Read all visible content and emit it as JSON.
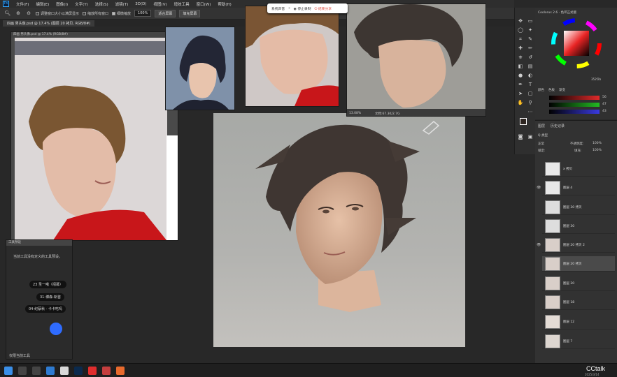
{
  "menubar": {
    "logo": "Ps",
    "items": [
      "文件(F)",
      "编辑(E)",
      "图像(I)",
      "文字(Y)",
      "选择(S)",
      "滤镜(T)",
      "3D(D)",
      "视图(V)",
      "增效工具",
      "窗口(W)",
      "帮助(H)"
    ]
  },
  "options": {
    "check_resize": "调整窗口大小以满屏显示",
    "check_all_windows": "缩放所有窗口",
    "check_scrubby": "细微缩放",
    "zoom_value": "100%",
    "fit_screen": "适合屏幕",
    "fill_screen": "填充屏幕"
  },
  "tabs": [
    {
      "label": "四画  男头像.psd @ 17.4% (图层 20 拷贝, RGB/8#)"
    }
  ],
  "windows": {
    "small_title": "四画  男头像.psd @ 17.4% (RGB/8#)",
    "ref2_status": "13.08%",
    "ref2_status2": "文档:67.3K/2.7G"
  },
  "recorder": {
    "mic": "系统声音",
    "stop": "停止录制",
    "end": "结束分享"
  },
  "color_panel": {
    "title": "Coolorus 2.6 · 色环正式版",
    "tabs": [
      "颜色",
      "色板",
      "渐变"
    ],
    "slider_values": [
      "56",
      "47",
      "43"
    ],
    "hex_readout": "352f2b"
  },
  "layers_panel": {
    "tabs": [
      "图层",
      "历史记录"
    ],
    "kind_label": "Q 类型",
    "blend": "正常",
    "opacity_label": "不透明度:",
    "opacity": "100%",
    "fill_label": "填充:",
    "fill": "100%",
    "lock_label": "锁定:",
    "layers": [
      {
        "name": "x 拷贝",
        "visible": false,
        "selected": false
      },
      {
        "name": "图层 4",
        "visible": true,
        "selected": false
      },
      {
        "name": "图层 30 拷贝",
        "visible": false,
        "selected": false
      },
      {
        "name": "图层 30",
        "visible": false,
        "selected": false
      },
      {
        "name": "图层 20 拷贝 2",
        "visible": true,
        "selected": false
      },
      {
        "name": "图层 20 拷贝",
        "visible": false,
        "selected": true
      },
      {
        "name": "图层 20",
        "visible": false,
        "selected": false
      },
      {
        "name": "图层 18",
        "visible": false,
        "selected": false
      },
      {
        "name": "图层 12",
        "visible": false,
        "selected": false
      },
      {
        "name": "图层 7",
        "visible": false,
        "selected": false
      }
    ]
  },
  "presets_panel": {
    "title": "工具预设",
    "empty_text": "当前工具没有定义的工具预设。",
    "presets": [
      "23 圣一哦（招募）",
      "31-博森-斩首",
      "04-纪蔡秋 · 卡卡吃吗"
    ],
    "current_tool_only": "仅限当前工具"
  },
  "taskbar": {
    "brand": "CCtalk",
    "date": "2025/3/14"
  },
  "colors": {
    "accent": "#31a8ff",
    "workspace": "#282828",
    "panel": "#303030",
    "canvas_bg": "#a8a9a6",
    "red_shirt": "#c8161a"
  }
}
